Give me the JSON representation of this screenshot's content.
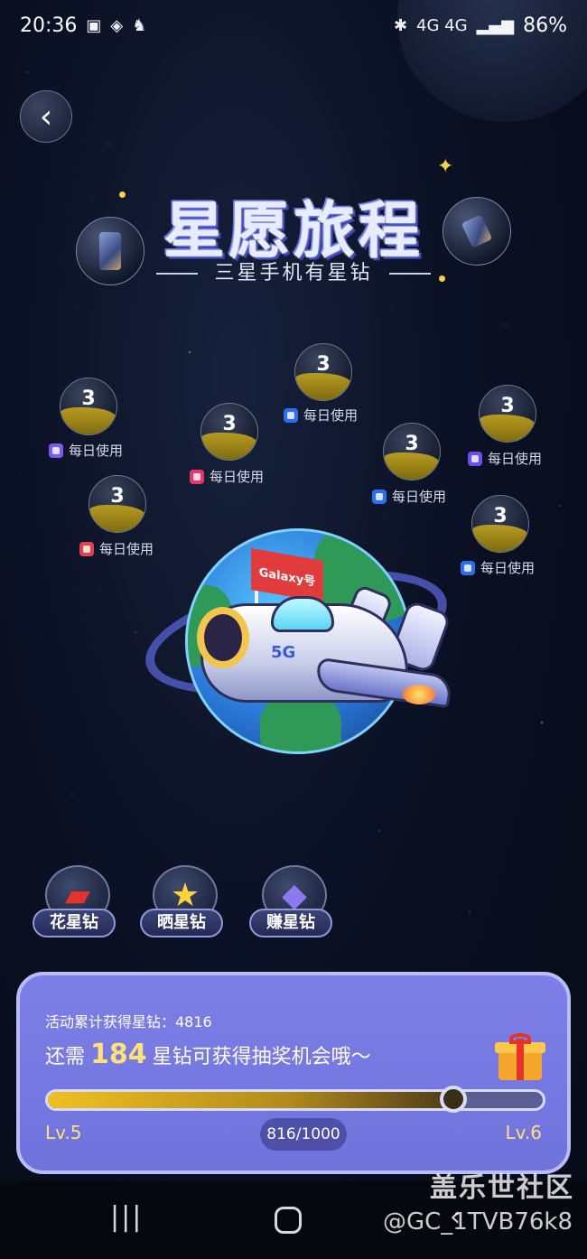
{
  "status_bar": {
    "time": "20:36",
    "battery": "86%",
    "signal": "4G 4G"
  },
  "header": {
    "title": "星愿旅程",
    "subtitle": "三星手机有星钻"
  },
  "bubbles": [
    {
      "value": "3",
      "label": "每日使用",
      "icon": "grid-app-icon",
      "color": "#7c5cf0"
    },
    {
      "value": "3",
      "label": "每日使用",
      "icon": "tasks-app-icon",
      "color": "#e03a6a"
    },
    {
      "value": "3",
      "label": "每日使用",
      "icon": "notes-app-icon",
      "color": "#e0434a"
    },
    {
      "value": "3",
      "label": "每日使用",
      "icon": "wallet-app-icon",
      "color": "#2a6ff0"
    },
    {
      "value": "3",
      "label": "每日使用",
      "icon": "health-app-icon",
      "color": "#2a6ff0"
    },
    {
      "value": "3",
      "label": "每日使用",
      "icon": "home-app-icon",
      "color": "#6a4ef0"
    },
    {
      "value": "3",
      "label": "每日使用",
      "icon": "gallery-app-icon",
      "color": "#2a6ff0"
    }
  ],
  "flag_text": "Galaxy号",
  "plane_text": "5G",
  "menu": [
    {
      "label": "花星钻",
      "icon": "shopping-bag-icon"
    },
    {
      "label": "晒星钻",
      "icon": "star-icon"
    },
    {
      "label": "赚星钻",
      "icon": "diamond-icon"
    }
  ],
  "card": {
    "total_text": "活动累计获得星钻：4816",
    "msg_prefix": "还需",
    "msg_number": "184",
    "msg_suffix": "星钻可获得抽奖机会哦～",
    "progress_fraction": 0.816,
    "progress_text": "816/1000",
    "level_from": "Lv.5",
    "level_to": "Lv.6"
  },
  "watermark": {
    "site": "盖乐世社区",
    "user": "@GC_1TVB76k8"
  },
  "colors": {
    "accent_gold": "#ffe176",
    "card_bg": "#7d7fe6"
  }
}
